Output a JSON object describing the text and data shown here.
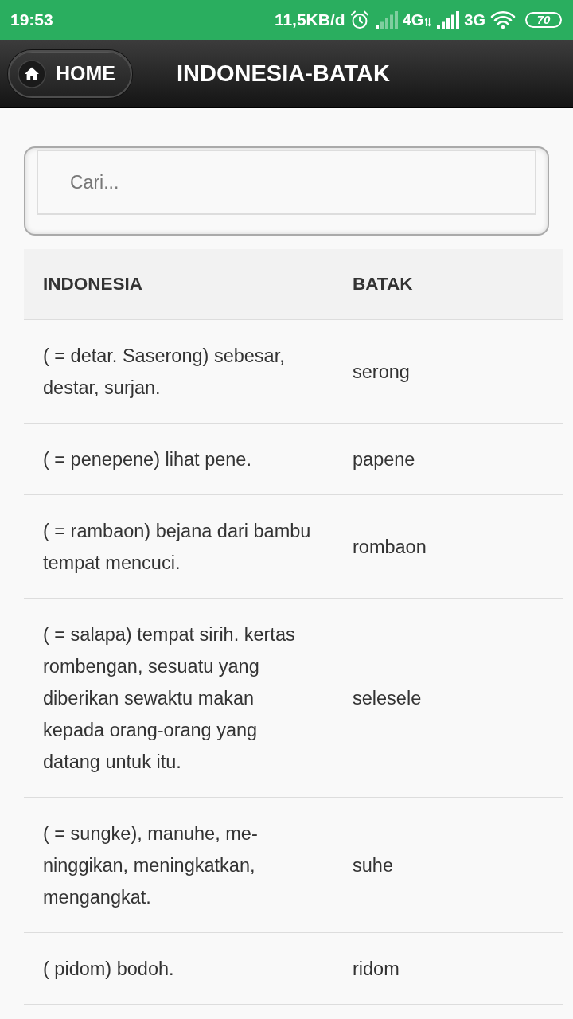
{
  "status_bar": {
    "time": "19:53",
    "speed": "11,5KB/d",
    "network_1": "4G",
    "network_2": "3G",
    "battery": "70"
  },
  "header": {
    "home_button": "HOME",
    "title": "INDONESIA-BATAK"
  },
  "search": {
    "placeholder": "Cari..."
  },
  "table": {
    "columns": [
      "INDONESIA",
      "BATAK"
    ],
    "rows": [
      [
        "( = detar. Saserong) sebesar, destar, surjan.",
        "serong"
      ],
      [
        "( = penepene) lihat pene.",
        "papene"
      ],
      [
        "( = rambaon) bejana dari bambu tempat mencuci.",
        "rombaon"
      ],
      [
        "( = salapa) tempat sirih. kertas rombengan, sesuatu yang diberikan sewaktu makan kepada orang-orang yang datang untuk itu.",
        "selesele"
      ],
      [
        "( = sungke), manuhe, me-ninggikan, meningkatkan, mengangkat.",
        "suhe"
      ],
      [
        "( pidom) bodoh.",
        "ridom"
      ]
    ]
  }
}
